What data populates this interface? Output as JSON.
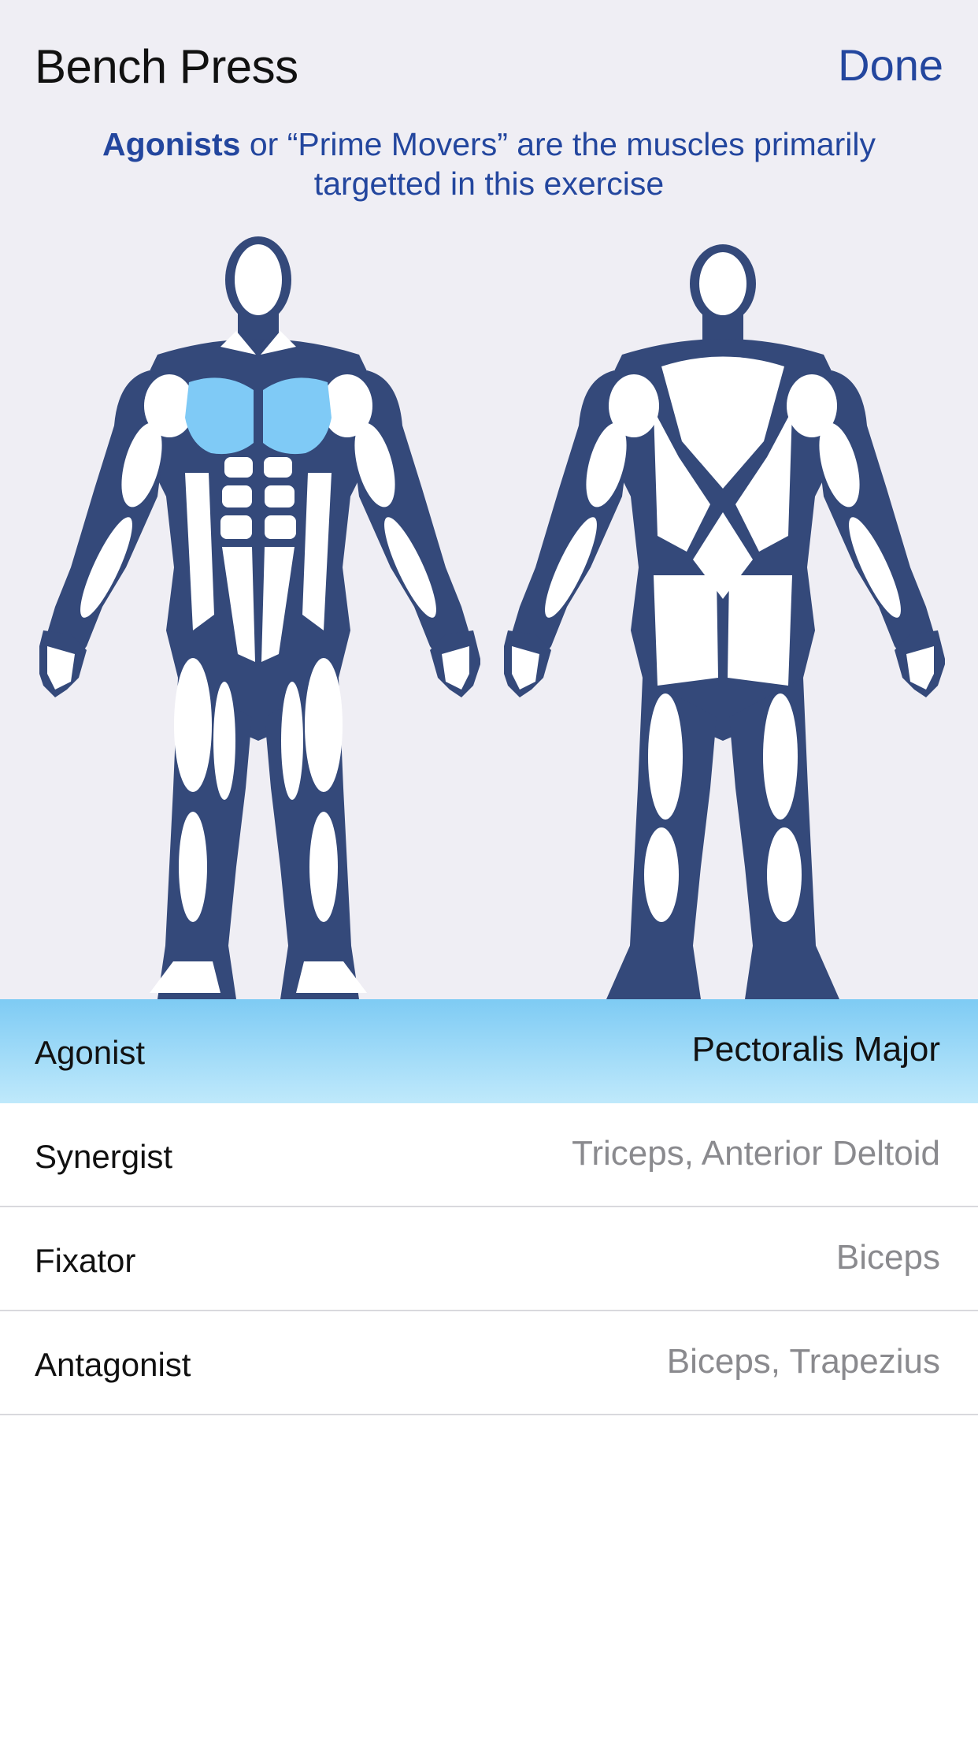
{
  "header": {
    "title": "Bench Press",
    "done_label": "Done"
  },
  "info": {
    "bold": "Agonists",
    "rest": " or “Prime Movers” are the muscles primarily targetted in this exercise"
  },
  "figures": {
    "front_icon": "body-front-icon",
    "back_icon": "body-back-icon",
    "highlighted_muscle": "pectoralis-major",
    "body_color": "#34497a",
    "highlight_color": "#7fcaf6"
  },
  "muscle_rows": [
    {
      "label": "Agonist",
      "value": "Pectoralis Major",
      "selected": true
    },
    {
      "label": "Synergist",
      "value": "Triceps, Anterior Deltoid",
      "selected": false
    },
    {
      "label": "Fixator",
      "value": "Biceps",
      "selected": false
    },
    {
      "label": "Antagonist",
      "value": "Biceps, Trapezius",
      "selected": false
    }
  ]
}
